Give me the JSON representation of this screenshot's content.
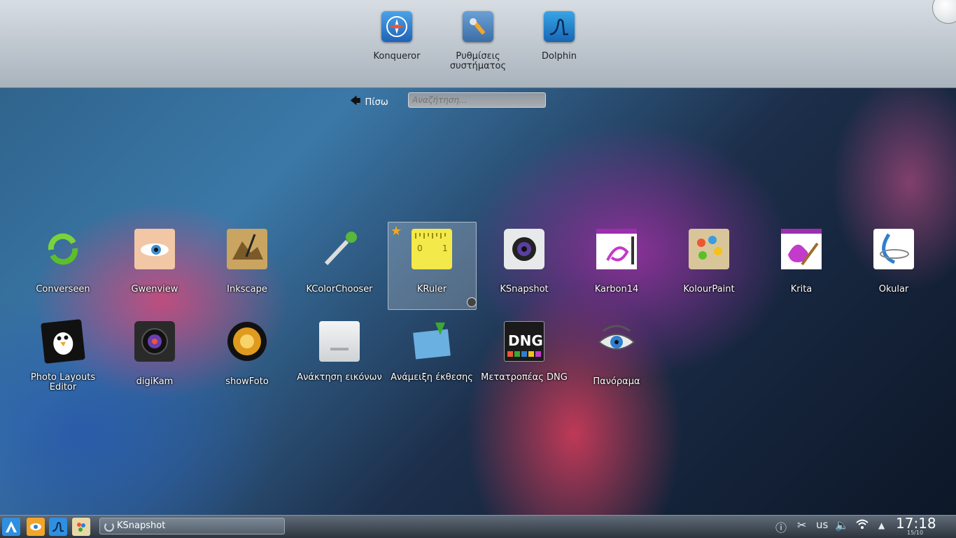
{
  "favorites": [
    {
      "label": "Konqueror",
      "icon": "compass-icon"
    },
    {
      "label": "Ρυθμίσεις συστήματος",
      "icon": "wrench-icon"
    },
    {
      "label": "Dolphin",
      "icon": "dolphin-icon"
    }
  ],
  "nav": {
    "back_label": "Πίσω",
    "search_placeholder": "Αναζήτηση..."
  },
  "apps_row1": [
    {
      "label": "Converseen"
    },
    {
      "label": "Gwenview"
    },
    {
      "label": "Inkscape"
    },
    {
      "label": "KColorChooser"
    },
    {
      "label": "KRuler"
    },
    {
      "label": "KSnapshot"
    },
    {
      "label": "Karbon14"
    },
    {
      "label": "KolourPaint"
    },
    {
      "label": "Krita"
    },
    {
      "label": "Okular"
    }
  ],
  "apps_row2": [
    {
      "label": "Photo Layouts Editor"
    },
    {
      "label": "digiKam"
    },
    {
      "label": "showFoto"
    },
    {
      "label": "Ανάκτηση εικόνων"
    },
    {
      "label": "Ανάμειξη έκθεσης"
    },
    {
      "label": "Μετατροπέας DNG"
    },
    {
      "label": "Πανόραμα"
    }
  ],
  "taskbar": {
    "task_label": "KSnapshot",
    "keyboard_layout": "us",
    "time": "17:18",
    "date": "15/10"
  },
  "colors": {
    "accent": "#f1a81c",
    "taskbar": "#3a434d"
  }
}
